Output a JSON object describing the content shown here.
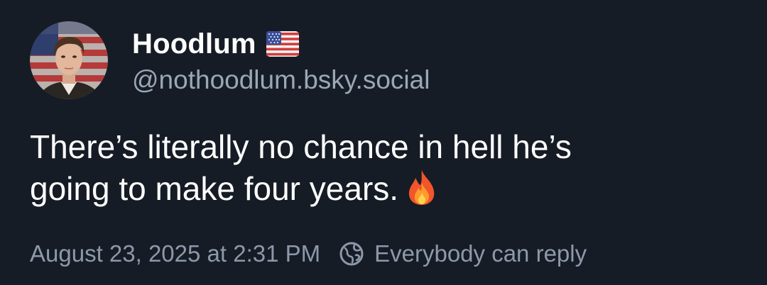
{
  "author": {
    "display_name": "Hoodlum",
    "name_emoji": "us-flag-icon",
    "handle": "@nothoodlum.bsky.social"
  },
  "post": {
    "text_line_1": "There’s literally no chance in hell he’s",
    "text_line_2": "going to make four years.",
    "emoji": "fire-icon"
  },
  "meta": {
    "timestamp": "August 23, 2025 at 2:31 PM",
    "reply_setting": "Everybody can reply",
    "reply_icon": "globe-icon"
  },
  "colors": {
    "background": "#161c25",
    "primary_text": "#ffffff",
    "secondary_text": "#9aa7b8"
  }
}
